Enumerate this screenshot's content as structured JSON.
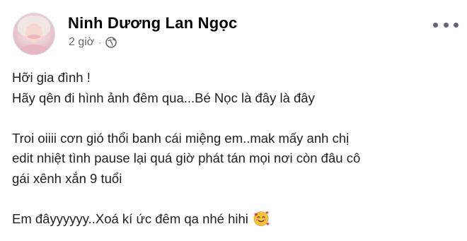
{
  "post": {
    "author": {
      "name": "Ninh Dương Lan Ngọc"
    },
    "timestamp": "2 giờ",
    "separator": "·",
    "privacy_icon": "globe-icon",
    "menu_icon": "more-horizontal-icon",
    "text": {
      "line1": "Hỡi gia đình !",
      "line2": "Hãy qên đi hình ảnh đêm qua...Bé Nọc là đây là đây",
      "line3": "Troi oiiii cơn gió thổi banh cái miệng em..mak mấy anh chị",
      "line4": "edit nhiệt tình pause lại quá giờ phát tán mọi nơi còn đâu cô",
      "line5": "gái xênh xắn 9 tuổi",
      "line6": "Em đâyyyyyy..Xoá kí ức đêm qa nhé hihi"
    },
    "emoji": "smiling-face-with-hearts-icon"
  },
  "colors": {
    "name": "#050505",
    "meta": "#65676b",
    "body_text": "#1c1e21"
  }
}
